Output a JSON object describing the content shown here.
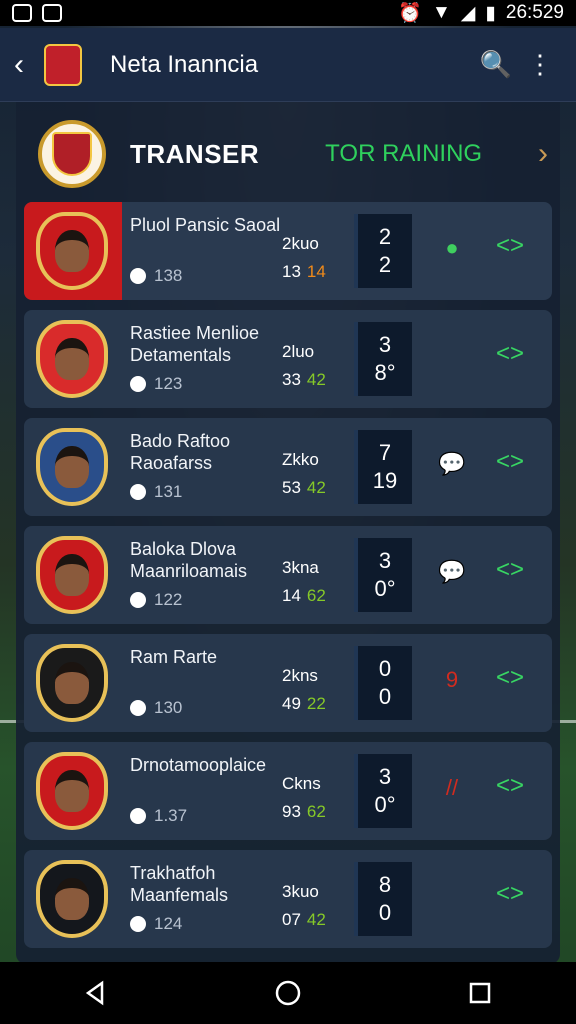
{
  "status": {
    "time": "26:529"
  },
  "appbar": {
    "title": "Neta Inanncia"
  },
  "header": {
    "title": "TRANSER",
    "ranking": "TOR RAINING"
  },
  "players": [
    {
      "name": "Pluol Pansic Saoal",
      "meta": "138",
      "stat1": "2kuo",
      "stat2": "13",
      "stat3": "14",
      "score_top": "2",
      "score_bot": "2",
      "badge": "●"
    },
    {
      "name": "Rastiee Menlioe Detamentals",
      "meta": "123",
      "stat1": "2luo",
      "stat2": "33",
      "stat3": "42",
      "score_top": "3",
      "score_bot": "8°",
      "badge": ""
    },
    {
      "name": "Bado Raftoo Raoafarss",
      "meta": "131",
      "stat1": "Zkko",
      "stat2": "53",
      "stat3": "42",
      "score_top": "7",
      "score_bot": "19",
      "badge": "💬"
    },
    {
      "name": "Baloka Dlova Maanriloamais",
      "meta": "122",
      "stat1": "3kna",
      "stat2": "14",
      "stat3": "62",
      "score_top": "3",
      "score_bot": "0°",
      "badge": "💬"
    },
    {
      "name": "Ram Rarte",
      "meta": "130",
      "stat1": "2kns",
      "stat2": "49",
      "stat3": "22",
      "score_top": "0",
      "score_bot": "0",
      "badge": "9"
    },
    {
      "name": "Drnotamooplaice",
      "meta": "1.37",
      "stat1": "Ckns",
      "stat2": "93",
      "stat3": "62",
      "score_top": "3",
      "score_bot": "0°",
      "badge": "//"
    },
    {
      "name": "Trakhatfoh Maanfemals",
      "meta": "124",
      "stat1": "3kuo",
      "stat2": "07",
      "stat3": "42",
      "score_top": "8",
      "score_bot": "0",
      "badge": ""
    }
  ]
}
